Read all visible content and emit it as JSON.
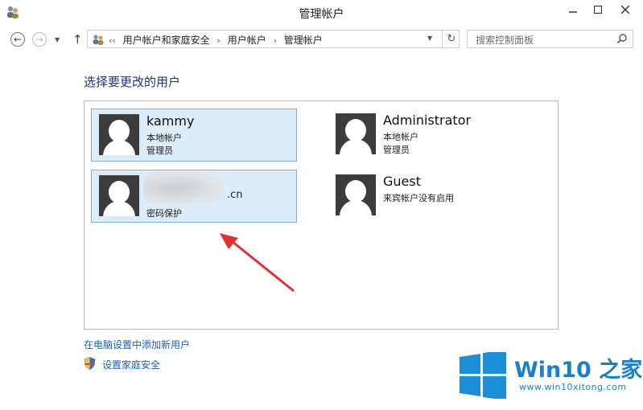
{
  "window": {
    "title": "管理帐户",
    "minimize_label": "–",
    "restore_label": "□",
    "close_label": "✕"
  },
  "addressbar": {
    "breadcrumbs": [
      "‹‹",
      "用户帐户和家庭安全",
      "›",
      "用户帐户",
      "›",
      "管理帐户"
    ],
    "search_placeholder": "搜索控制面板"
  },
  "heading": "选择要更改的用户",
  "accounts": [
    {
      "name": "kammy",
      "line1": "本地帐户",
      "line2": "管理员",
      "selected": true
    },
    {
      "name": "Administrator",
      "line1": "本地帐户",
      "line2": "管理员",
      "selected": false
    },
    {
      "name_suffix": ".cn",
      "line1": "密码保护",
      "selected": true
    },
    {
      "name": "Guest",
      "line1": "来宾帐户没有启用",
      "selected": false
    }
  ],
  "links": {
    "add_user": "在电脑设置中添加新用户",
    "family_safety": "设置家庭安全"
  },
  "watermark": {
    "brand": "Win10",
    "brand_suffix": "之家",
    "url": "www.win10xitong.com"
  },
  "colors": {
    "selection_bg": "#dcecf8",
    "selection_border": "#84acdd",
    "link": "#1a5ec2",
    "heading": "#1e3287",
    "arrow": "#e03030",
    "brand": "#1d7fc8"
  }
}
